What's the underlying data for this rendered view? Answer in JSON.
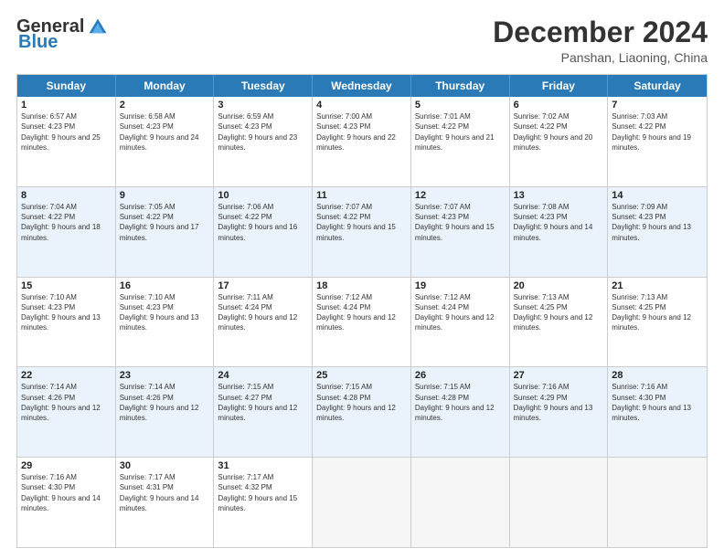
{
  "header": {
    "logo_general": "General",
    "logo_blue": "Blue",
    "month_title": "December 2024",
    "subtitle": "Panshan, Liaoning, China"
  },
  "calendar": {
    "days_of_week": [
      "Sunday",
      "Monday",
      "Tuesday",
      "Wednesday",
      "Thursday",
      "Friday",
      "Saturday"
    ],
    "rows": [
      {
        "alt": false,
        "cells": [
          {
            "day": "1",
            "sunrise": "Sunrise: 6:57 AM",
            "sunset": "Sunset: 4:23 PM",
            "daylight": "Daylight: 9 hours and 25 minutes."
          },
          {
            "day": "2",
            "sunrise": "Sunrise: 6:58 AM",
            "sunset": "Sunset: 4:23 PM",
            "daylight": "Daylight: 9 hours and 24 minutes."
          },
          {
            "day": "3",
            "sunrise": "Sunrise: 6:59 AM",
            "sunset": "Sunset: 4:23 PM",
            "daylight": "Daylight: 9 hours and 23 minutes."
          },
          {
            "day": "4",
            "sunrise": "Sunrise: 7:00 AM",
            "sunset": "Sunset: 4:23 PM",
            "daylight": "Daylight: 9 hours and 22 minutes."
          },
          {
            "day": "5",
            "sunrise": "Sunrise: 7:01 AM",
            "sunset": "Sunset: 4:22 PM",
            "daylight": "Daylight: 9 hours and 21 minutes."
          },
          {
            "day": "6",
            "sunrise": "Sunrise: 7:02 AM",
            "sunset": "Sunset: 4:22 PM",
            "daylight": "Daylight: 9 hours and 20 minutes."
          },
          {
            "day": "7",
            "sunrise": "Sunrise: 7:03 AM",
            "sunset": "Sunset: 4:22 PM",
            "daylight": "Daylight: 9 hours and 19 minutes."
          }
        ]
      },
      {
        "alt": true,
        "cells": [
          {
            "day": "8",
            "sunrise": "Sunrise: 7:04 AM",
            "sunset": "Sunset: 4:22 PM",
            "daylight": "Daylight: 9 hours and 18 minutes."
          },
          {
            "day": "9",
            "sunrise": "Sunrise: 7:05 AM",
            "sunset": "Sunset: 4:22 PM",
            "daylight": "Daylight: 9 hours and 17 minutes."
          },
          {
            "day": "10",
            "sunrise": "Sunrise: 7:06 AM",
            "sunset": "Sunset: 4:22 PM",
            "daylight": "Daylight: 9 hours and 16 minutes."
          },
          {
            "day": "11",
            "sunrise": "Sunrise: 7:07 AM",
            "sunset": "Sunset: 4:22 PM",
            "daylight": "Daylight: 9 hours and 15 minutes."
          },
          {
            "day": "12",
            "sunrise": "Sunrise: 7:07 AM",
            "sunset": "Sunset: 4:23 PM",
            "daylight": "Daylight: 9 hours and 15 minutes."
          },
          {
            "day": "13",
            "sunrise": "Sunrise: 7:08 AM",
            "sunset": "Sunset: 4:23 PM",
            "daylight": "Daylight: 9 hours and 14 minutes."
          },
          {
            "day": "14",
            "sunrise": "Sunrise: 7:09 AM",
            "sunset": "Sunset: 4:23 PM",
            "daylight": "Daylight: 9 hours and 13 minutes."
          }
        ]
      },
      {
        "alt": false,
        "cells": [
          {
            "day": "15",
            "sunrise": "Sunrise: 7:10 AM",
            "sunset": "Sunset: 4:23 PM",
            "daylight": "Daylight: 9 hours and 13 minutes."
          },
          {
            "day": "16",
            "sunrise": "Sunrise: 7:10 AM",
            "sunset": "Sunset: 4:23 PM",
            "daylight": "Daylight: 9 hours and 13 minutes."
          },
          {
            "day": "17",
            "sunrise": "Sunrise: 7:11 AM",
            "sunset": "Sunset: 4:24 PM",
            "daylight": "Daylight: 9 hours and 12 minutes."
          },
          {
            "day": "18",
            "sunrise": "Sunrise: 7:12 AM",
            "sunset": "Sunset: 4:24 PM",
            "daylight": "Daylight: 9 hours and 12 minutes."
          },
          {
            "day": "19",
            "sunrise": "Sunrise: 7:12 AM",
            "sunset": "Sunset: 4:24 PM",
            "daylight": "Daylight: 9 hours and 12 minutes."
          },
          {
            "day": "20",
            "sunrise": "Sunrise: 7:13 AM",
            "sunset": "Sunset: 4:25 PM",
            "daylight": "Daylight: 9 hours and 12 minutes."
          },
          {
            "day": "21",
            "sunrise": "Sunrise: 7:13 AM",
            "sunset": "Sunset: 4:25 PM",
            "daylight": "Daylight: 9 hours and 12 minutes."
          }
        ]
      },
      {
        "alt": true,
        "cells": [
          {
            "day": "22",
            "sunrise": "Sunrise: 7:14 AM",
            "sunset": "Sunset: 4:26 PM",
            "daylight": "Daylight: 9 hours and 12 minutes."
          },
          {
            "day": "23",
            "sunrise": "Sunrise: 7:14 AM",
            "sunset": "Sunset: 4:26 PM",
            "daylight": "Daylight: 9 hours and 12 minutes."
          },
          {
            "day": "24",
            "sunrise": "Sunrise: 7:15 AM",
            "sunset": "Sunset: 4:27 PM",
            "daylight": "Daylight: 9 hours and 12 minutes."
          },
          {
            "day": "25",
            "sunrise": "Sunrise: 7:15 AM",
            "sunset": "Sunset: 4:28 PM",
            "daylight": "Daylight: 9 hours and 12 minutes."
          },
          {
            "day": "26",
            "sunrise": "Sunrise: 7:15 AM",
            "sunset": "Sunset: 4:28 PM",
            "daylight": "Daylight: 9 hours and 12 minutes."
          },
          {
            "day": "27",
            "sunrise": "Sunrise: 7:16 AM",
            "sunset": "Sunset: 4:29 PM",
            "daylight": "Daylight: 9 hours and 13 minutes."
          },
          {
            "day": "28",
            "sunrise": "Sunrise: 7:16 AM",
            "sunset": "Sunset: 4:30 PM",
            "daylight": "Daylight: 9 hours and 13 minutes."
          }
        ]
      },
      {
        "alt": false,
        "cells": [
          {
            "day": "29",
            "sunrise": "Sunrise: 7:16 AM",
            "sunset": "Sunset: 4:30 PM",
            "daylight": "Daylight: 9 hours and 14 minutes."
          },
          {
            "day": "30",
            "sunrise": "Sunrise: 7:17 AM",
            "sunset": "Sunset: 4:31 PM",
            "daylight": "Daylight: 9 hours and 14 minutes."
          },
          {
            "day": "31",
            "sunrise": "Sunrise: 7:17 AM",
            "sunset": "Sunset: 4:32 PM",
            "daylight": "Daylight: 9 hours and 15 minutes."
          },
          {
            "day": "",
            "sunrise": "",
            "sunset": "",
            "daylight": ""
          },
          {
            "day": "",
            "sunrise": "",
            "sunset": "",
            "daylight": ""
          },
          {
            "day": "",
            "sunrise": "",
            "sunset": "",
            "daylight": ""
          },
          {
            "day": "",
            "sunrise": "",
            "sunset": "",
            "daylight": ""
          }
        ]
      }
    ]
  }
}
